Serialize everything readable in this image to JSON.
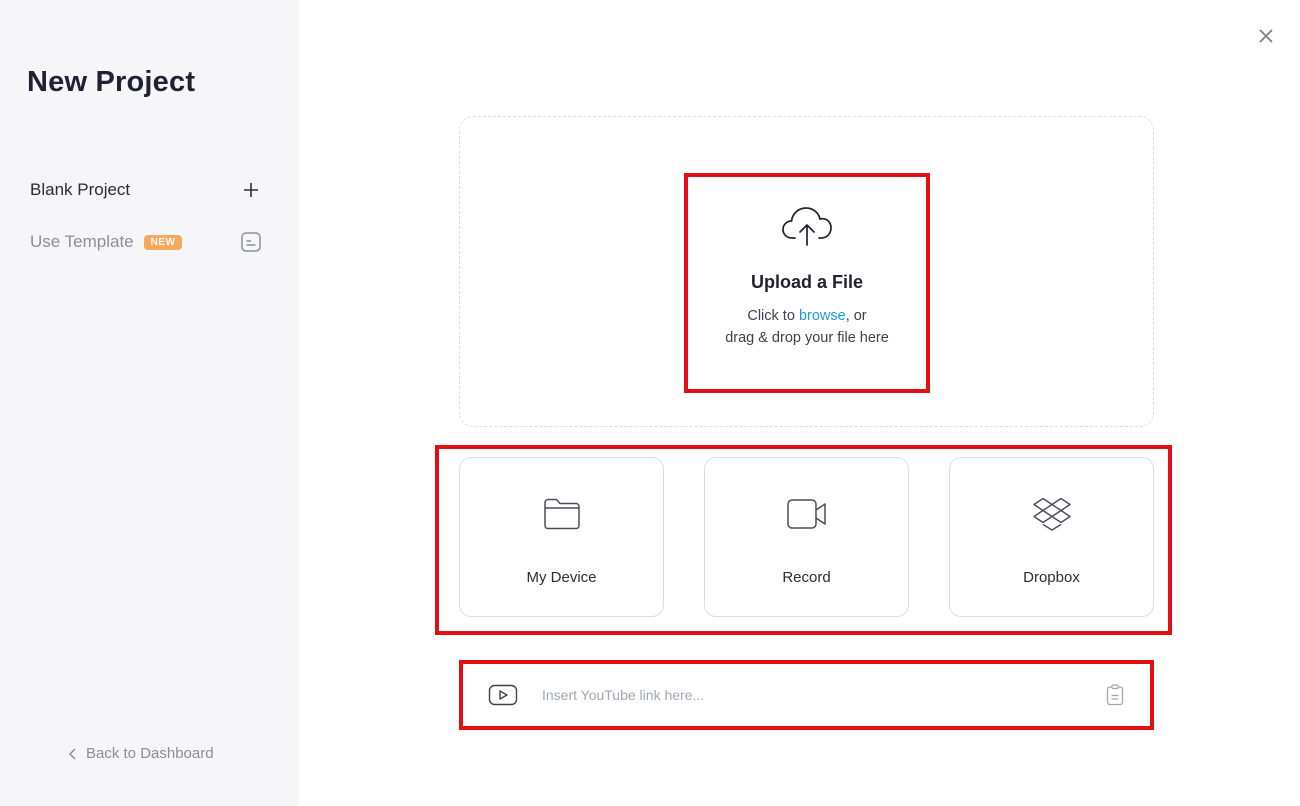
{
  "sidebar": {
    "title": "New Project",
    "items": [
      {
        "label": "Blank Project",
        "icon": "plus-icon"
      },
      {
        "label": "Use Template",
        "badge": "NEW",
        "icon": "template-icon"
      }
    ],
    "back_label": "Back to Dashboard"
  },
  "upload": {
    "title": "Upload a File",
    "desc_prefix": "Click to ",
    "browse_label": "browse",
    "desc_suffix": ", or",
    "desc_line2": "drag & drop your file here",
    "icon": "cloud-upload-icon"
  },
  "sources": [
    {
      "label": "My Device",
      "icon": "folder-icon"
    },
    {
      "label": "Record",
      "icon": "video-camera-icon"
    },
    {
      "label": "Dropbox",
      "icon": "dropbox-icon"
    }
  ],
  "youtube": {
    "placeholder": "Insert YouTube link here...",
    "value": "",
    "icon": "youtube-play-icon",
    "paste_icon": "paste-icon"
  },
  "colors": {
    "sidebar_bg": "#f6f6f8",
    "accent_link": "#1a9ed4",
    "badge": "#f5a95a",
    "highlight": "#e40f12"
  }
}
